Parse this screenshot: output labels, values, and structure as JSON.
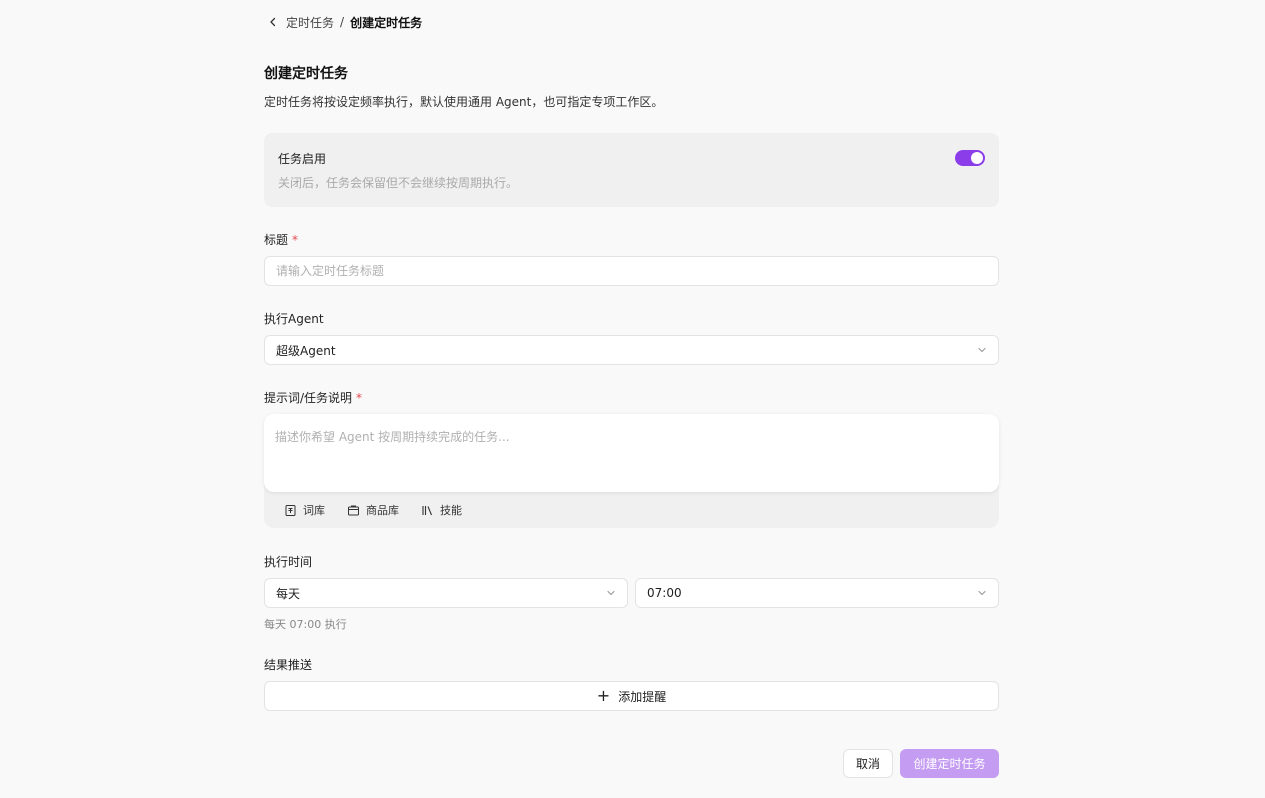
{
  "breadcrumb": {
    "parent": "定时任务",
    "separator": "/",
    "current": "创建定时任务"
  },
  "page": {
    "title": "创建定时任务",
    "description": "定时任务将按设定频率执行，默认使用通用 Agent，也可指定专项工作区。"
  },
  "enable": {
    "title": "任务启用",
    "description": "关闭后，任务会保留但不会继续按周期执行。",
    "enabled": true
  },
  "title_field": {
    "label": "标题",
    "required_mark": "*",
    "placeholder": "请输入定时任务标题"
  },
  "agent_field": {
    "label": "执行Agent",
    "value": "超级Agent"
  },
  "prompt_field": {
    "label": "提示词/任务说明",
    "required_mark": "*",
    "placeholder": "描述你希望 Agent 按周期持续完成的任务...",
    "tools": [
      {
        "label": "词库",
        "icon": "dictionary-icon"
      },
      {
        "label": "商品库",
        "icon": "product-library-icon"
      },
      {
        "label": "技能",
        "icon": "skills-icon"
      }
    ]
  },
  "schedule": {
    "label": "执行时间",
    "frequency": "每天",
    "time": "07:00",
    "hint": "每天 07:00 执行"
  },
  "delivery": {
    "label": "结果推送",
    "add_label": "添加提醒"
  },
  "actions": {
    "cancel": "取消",
    "submit": "创建定时任务"
  },
  "colors": {
    "accent": "#8b3dea",
    "submit_disabled": "#c49cf2",
    "required": "#e5484d"
  }
}
